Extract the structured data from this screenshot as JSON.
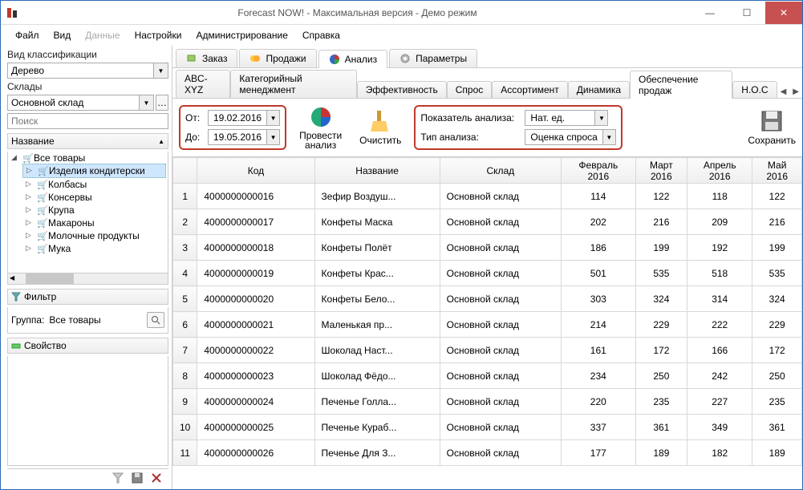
{
  "window": {
    "title": "Forecast NOW! - Максимальная версия - Демо режим"
  },
  "menu": {
    "file": "Файл",
    "view": "Вид",
    "data": "Данные",
    "settings": "Настройки",
    "admin": "Администрирование",
    "help": "Справка"
  },
  "sidebar": {
    "class_label": "Вид классификации",
    "class_value": "Дерево",
    "wh_label": "Склады",
    "wh_value": "Основной склад",
    "search_placeholder": "Поиск",
    "tree_header": "Название",
    "tree": {
      "root": "Все товары",
      "items": [
        "Изделия кондитерски",
        "Колбасы",
        "Консервы",
        "Крупа",
        "Макароны",
        "Молочные продукты",
        "Мука"
      ]
    },
    "filter": "Фильтр",
    "group_label": "Группа:",
    "group_value": "Все товары",
    "property": "Свойство"
  },
  "tabs": {
    "order": "Заказ",
    "sales": "Продажи",
    "analysis": "Анализ",
    "params": "Параметры"
  },
  "subtabs": {
    "abc": "ABC-XYZ",
    "cat": "Категорийный менеджмент",
    "eff": "Эффективность",
    "demand": "Спрос",
    "assort": "Ассортимент",
    "dyn": "Динамика",
    "supply": "Обеспечение продаж",
    "noc": "Н.О.С"
  },
  "toolbar": {
    "from_label": "От:",
    "to_label": "До:",
    "from_value": "19.02.2016",
    "to_value": "19.05.2016",
    "run": "Провести анализ",
    "clear": "Очистить",
    "indicator_label": "Показатель анализа:",
    "indicator_value": "Нат. ед.",
    "type_label": "Тип анализа:",
    "type_value": "Оценка спроса",
    "save": "Сохранить"
  },
  "grid": {
    "headers": {
      "code": "Код",
      "name": "Название",
      "wh": "Склад",
      "m1": "Февраль 2016",
      "m2": "Март 2016",
      "m3": "Апрель 2016",
      "m4": "Май 2016"
    },
    "wh": "Основной склад",
    "rows": [
      {
        "n": "1",
        "code": "4000000000016",
        "name": "Зефир Воздуш...",
        "v": [
          "114",
          "122",
          "118",
          "122"
        ]
      },
      {
        "n": "2",
        "code": "4000000000017",
        "name": "Конфеты Маска",
        "v": [
          "202",
          "216",
          "209",
          "216"
        ]
      },
      {
        "n": "3",
        "code": "4000000000018",
        "name": "Конфеты Полёт",
        "v": [
          "186",
          "199",
          "192",
          "199"
        ]
      },
      {
        "n": "4",
        "code": "4000000000019",
        "name": "Конфеты Крас...",
        "v": [
          "501",
          "535",
          "518",
          "535"
        ]
      },
      {
        "n": "5",
        "code": "4000000000020",
        "name": "Конфеты Бело...",
        "v": [
          "303",
          "324",
          "314",
          "324"
        ]
      },
      {
        "n": "6",
        "code": "4000000000021",
        "name": "Маленькая пр...",
        "v": [
          "214",
          "229",
          "222",
          "229"
        ]
      },
      {
        "n": "7",
        "code": "4000000000022",
        "name": "Шоколад Наст...",
        "v": [
          "161",
          "172",
          "166",
          "172"
        ]
      },
      {
        "n": "8",
        "code": "4000000000023",
        "name": "Шоколад Фёдо...",
        "v": [
          "234",
          "250",
          "242",
          "250"
        ]
      },
      {
        "n": "9",
        "code": "4000000000024",
        "name": "Печенье Голла...",
        "v": [
          "220",
          "235",
          "227",
          "235"
        ]
      },
      {
        "n": "10",
        "code": "4000000000025",
        "name": "Печенье Кураб...",
        "v": [
          "337",
          "361",
          "349",
          "361"
        ]
      },
      {
        "n": "11",
        "code": "4000000000026",
        "name": "Печенье Для З...",
        "v": [
          "177",
          "189",
          "182",
          "189"
        ]
      }
    ]
  }
}
